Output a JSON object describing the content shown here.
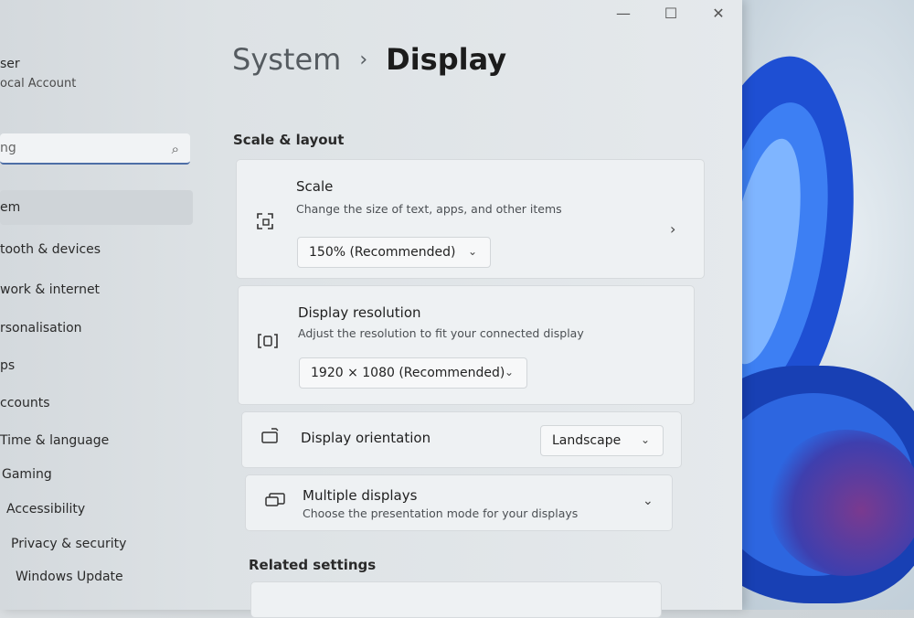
{
  "window": {
    "controls": {
      "minimize": "—",
      "maximize": "☐",
      "close": "✕"
    }
  },
  "sidebar": {
    "user_name": "ser",
    "user_sub": "ocal Account",
    "search_placeholder": "ng",
    "items": [
      {
        "label": "em",
        "active": true
      },
      {
        "label": "tooth & devices"
      },
      {
        "label": "work & internet"
      },
      {
        "label": "rsonalisation"
      },
      {
        "label": "ps"
      },
      {
        "label": "ccounts"
      },
      {
        "label": "Time & language"
      },
      {
        "label": "Gaming"
      },
      {
        "label": "Accessibility"
      },
      {
        "label": "Privacy & security"
      },
      {
        "label": "Windows Update"
      }
    ]
  },
  "breadcrumb": {
    "parent": "System",
    "separator": "›",
    "current": "Display"
  },
  "scale_layout": {
    "title": "Scale & layout",
    "scale": {
      "title": "Scale",
      "desc": "Change the size of text, apps, and other items",
      "value": "150% (Recommended)"
    },
    "resolution": {
      "title": "Display resolution",
      "desc": "Adjust the resolution to fit your connected display",
      "value": "1920 × 1080 (Recommended)"
    },
    "orientation": {
      "title": "Display orientation",
      "value": "Landscape"
    },
    "multiple": {
      "title": "Multiple displays",
      "desc": "Choose the presentation mode for your displays"
    }
  },
  "related": {
    "title": "Related settings"
  },
  "icons": {
    "search": "⌕",
    "chevron_down": "⌄",
    "chevron_right": "›"
  }
}
